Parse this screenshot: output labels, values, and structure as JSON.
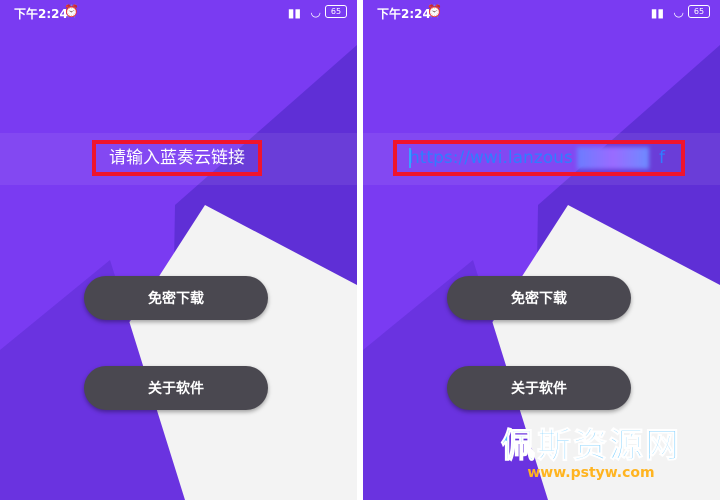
{
  "status_bar": {
    "time": "下午2:24",
    "battery": "65"
  },
  "left_screen": {
    "input_placeholder": "请输入蓝奏云链接",
    "buttons": {
      "download": "免密下载",
      "about": "关于软件"
    }
  },
  "right_screen": {
    "input_value": "https://wwi.lanzous",
    "input_value_tail": "f",
    "buttons": {
      "download": "免密下载",
      "about": "关于软件"
    }
  },
  "watermark": {
    "title": "佩斯资源网",
    "url": "www.pstyw.com"
  },
  "colors": {
    "purple": "#7a3bf2",
    "highlight_red": "#f0142d",
    "button_dark": "#4a4850"
  }
}
